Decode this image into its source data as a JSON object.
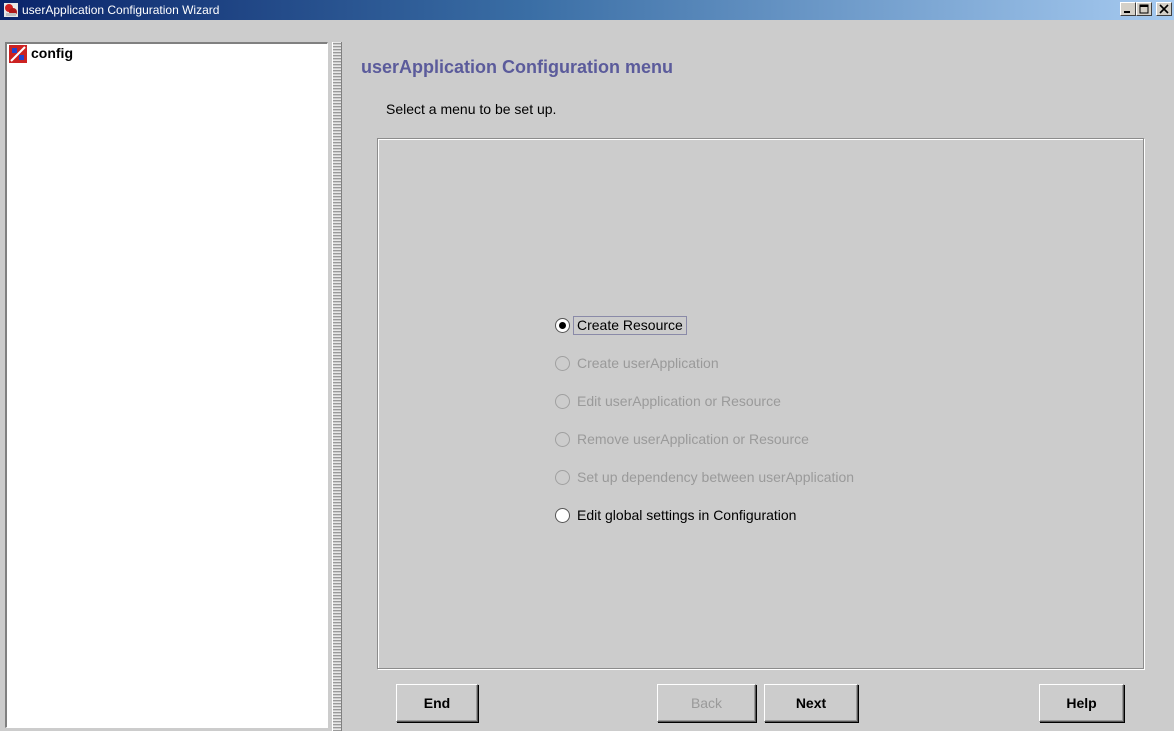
{
  "window": {
    "title": "userApplication Configuration Wizard",
    "controls": {
      "minimize": "minimize-icon",
      "maximize": "maximize-icon",
      "close": "close-icon"
    }
  },
  "tree": {
    "items": [
      {
        "label": "config",
        "icon": "config-icon"
      }
    ]
  },
  "main": {
    "title": "userApplication Configuration menu",
    "subtitle": "Select a menu to be set up.",
    "options": [
      {
        "label": "Create Resource",
        "checked": true,
        "enabled": true
      },
      {
        "label": "Create userApplication",
        "checked": false,
        "enabled": false
      },
      {
        "label": "Edit userApplication or Resource",
        "checked": false,
        "enabled": false
      },
      {
        "label": "Remove userApplication or Resource",
        "checked": false,
        "enabled": false
      },
      {
        "label": "Set up dependency between userApplication",
        "checked": false,
        "enabled": false
      },
      {
        "label": "Edit global settings in Configuration",
        "checked": false,
        "enabled": true
      }
    ]
  },
  "buttons": {
    "end": "End",
    "back": "Back",
    "next": "Next",
    "help": "Help"
  },
  "colors": {
    "title_text": "#5b5b9b",
    "disabled_text": "#9a9a9a",
    "background": "#cccccc"
  }
}
